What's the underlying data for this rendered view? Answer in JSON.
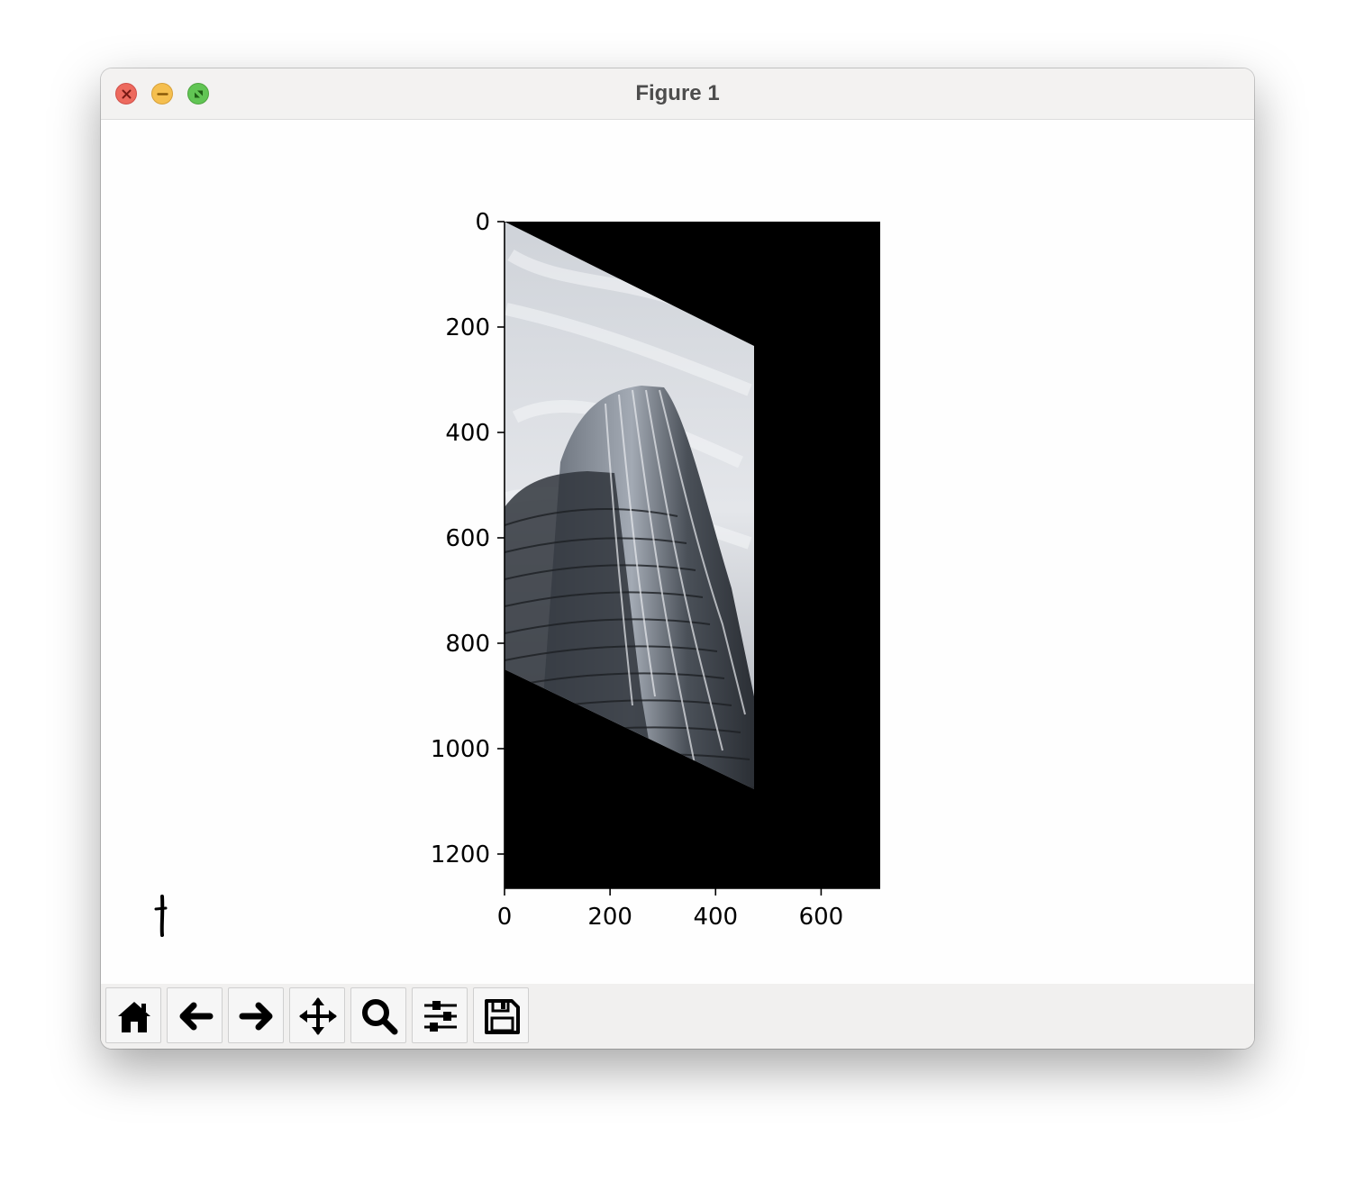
{
  "window": {
    "title": "Figure 1",
    "controls": [
      "close",
      "minimize",
      "zoom"
    ]
  },
  "chart_data": {
    "type": "image",
    "xlim": [
      0,
      712
    ],
    "ylim": [
      1265,
      0
    ],
    "xticks": [
      "0",
      "200",
      "400",
      "600"
    ],
    "yticks": [
      "0",
      "200",
      "400",
      "600",
      "800",
      "1000",
      "1200"
    ],
    "image_content": "grayscale skyscraper photo with affine (shear) transform, black background",
    "corner_mark": "†"
  },
  "toolbar": {
    "buttons": [
      {
        "name": "home",
        "icon": "home-icon"
      },
      {
        "name": "back",
        "icon": "arrow-left-icon"
      },
      {
        "name": "forward",
        "icon": "arrow-right-icon"
      },
      {
        "name": "pan",
        "icon": "move-icon"
      },
      {
        "name": "zoom",
        "icon": "magnifier-icon"
      },
      {
        "name": "configure-subplots",
        "icon": "sliders-icon"
      },
      {
        "name": "save",
        "icon": "floppy-disk-icon"
      }
    ]
  }
}
